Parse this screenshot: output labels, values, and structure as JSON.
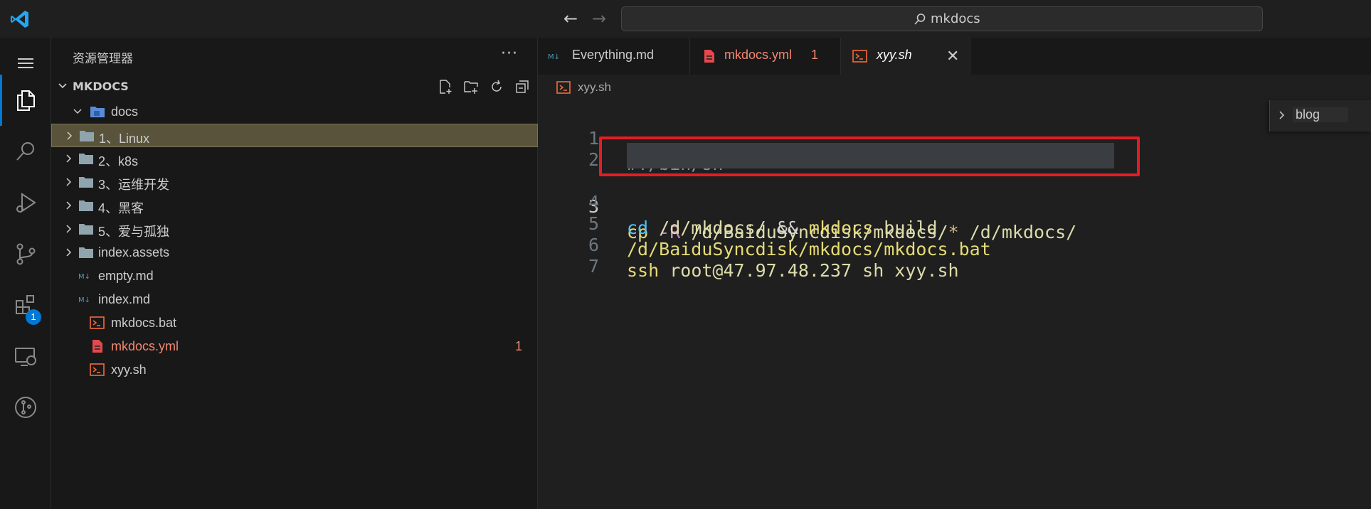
{
  "titlebar": {
    "search_text": "mkdocs"
  },
  "activity": {
    "extensions_badge": "1"
  },
  "sidebar": {
    "title": "资源管理器",
    "more": "···",
    "section_title": "MKDOCS",
    "tree": [
      {
        "label": "docs",
        "kind": "folder-open"
      },
      {
        "label": "1、Linux",
        "kind": "folder"
      },
      {
        "label": "2、k8s",
        "kind": "folder"
      },
      {
        "label": "3、运维开发",
        "kind": "folder"
      },
      {
        "label": "4、黑客",
        "kind": "folder"
      },
      {
        "label": "5、爱与孤独",
        "kind": "folder"
      },
      {
        "label": "index.assets",
        "kind": "folder"
      },
      {
        "label": "empty.md",
        "kind": "markdown"
      },
      {
        "label": "index.md",
        "kind": "markdown"
      },
      {
        "label": "mkdocs.bat",
        "kind": "shell"
      },
      {
        "label": "mkdocs.yml",
        "kind": "yaml",
        "problems": "1"
      },
      {
        "label": "xyy.sh",
        "kind": "shell"
      }
    ]
  },
  "editor": {
    "tabs": [
      {
        "label": "Everything.md",
        "icon": "markdown-icon"
      },
      {
        "label": "mkdocs.yml",
        "problems": "1",
        "icon": "yaml-icon"
      },
      {
        "label": "xyy.sh",
        "icon": "shell-icon",
        "active": true
      }
    ],
    "breadcrumb": "xyy.sh",
    "lines": [
      {
        "num": "1",
        "text": "#!/bin/sh"
      },
      {
        "num": "2",
        "text": ""
      },
      {
        "num": "3",
        "text": "cp -R /d/BaiduSyncdisk/mkdocs/* /d/mkdocs/"
      },
      {
        "num": "4",
        "text": "cd /d/mkdocs/ && mkdocs build"
      },
      {
        "num": "5",
        "text": "/d/BaiduSyncdisk/mkdocs/mkdocs.bat"
      },
      {
        "num": "6",
        "text": "ssh root@47.97.48.237 sh xyy.sh"
      },
      {
        "num": "7",
        "text": ""
      }
    ],
    "tokens": {
      "l3": {
        "cp": "cp",
        "flag": "-R",
        "p1": "/d/BaiduSyncdisk/mkdocs/",
        "star": "*",
        "p2": "/d/mkdocs/"
      },
      "l4": {
        "cd": "cd",
        "p1": "/d/mkdocs/",
        "op": "&&",
        "mk": "mkdocs",
        "build": "build"
      },
      "l5": {
        "p": "/d/BaiduSyncdisk/mkdocs/mkdocs.bat"
      },
      "l6": {
        "ssh": "ssh",
        "rest": "root@47.97.48.237 sh xyy.sh"
      }
    },
    "outline_peek": "blog"
  },
  "colors": {
    "accent": "#0078d4",
    "error": "#f48771",
    "highlight_box": "#e51c23",
    "selected_row": "#59533b"
  }
}
